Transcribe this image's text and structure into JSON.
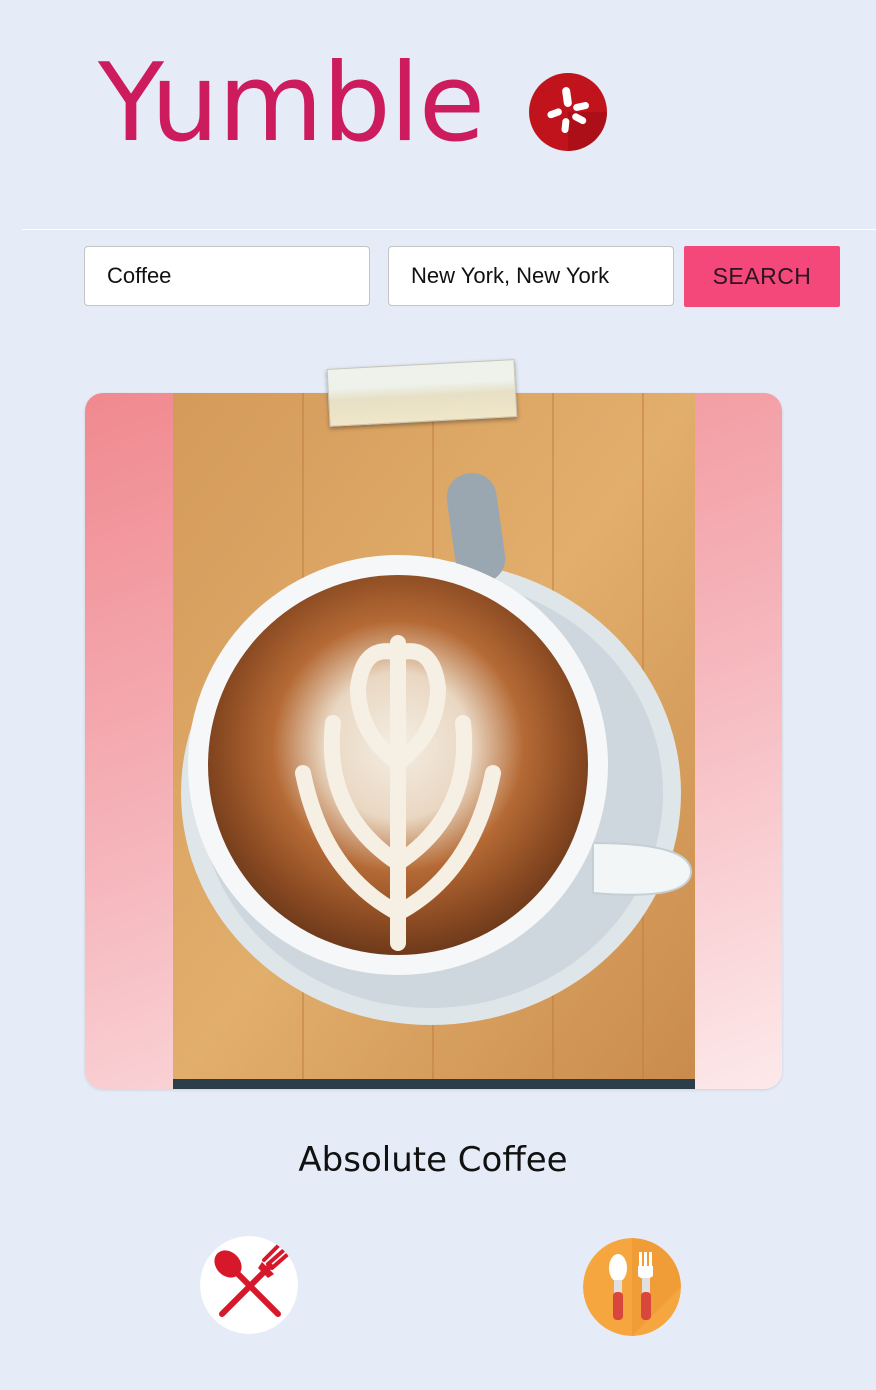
{
  "header": {
    "app_title": "Yumble",
    "logo_icon": "yelp-burst-icon"
  },
  "search": {
    "term_value": "Coffee",
    "location_value": "New York, New York",
    "search_label": "SEARCH"
  },
  "result": {
    "business_name": "Absolute Coffee",
    "photo_description_icon": "latte-art-photo"
  },
  "actions": {
    "reject_icon": "crossed-spoon-fork-icon",
    "accept_icon": "spoon-fork-icon"
  },
  "colors": {
    "brand": "#cc1c5e",
    "accent_button": "#f4477a",
    "background": "#e6ecf7",
    "logo_red": "#c0131c",
    "accept_circle": "#f5a63f"
  }
}
